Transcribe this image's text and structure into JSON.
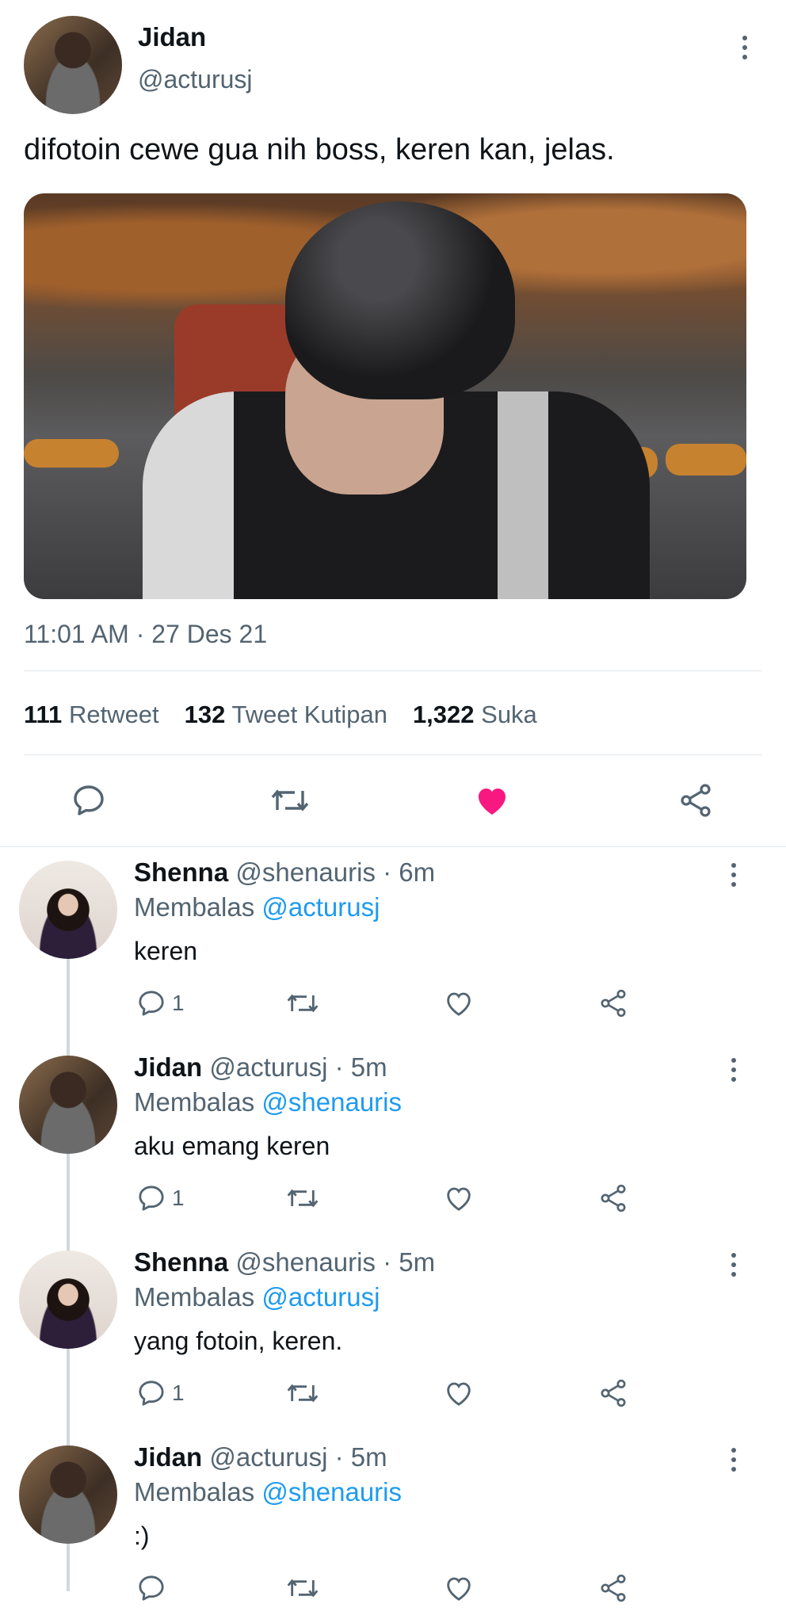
{
  "tweet": {
    "author_name": "Jidan",
    "author_handle": "@acturusj",
    "text": "difotoin cewe gua nih boss, keren kan, jelas.",
    "timestamp": "11:01 AM · 27 Des 21",
    "stats": [
      {
        "count": "111",
        "label": "Retweet"
      },
      {
        "count": "132",
        "label": "Tweet Kutipan"
      },
      {
        "count": "1,322",
        "label": "Suka"
      }
    ],
    "liked": true,
    "accent_like_color": "#f91880"
  },
  "replies": [
    {
      "name": "Shenna",
      "meta": "@shenauris · 6m",
      "reply_prefix": "Membalas",
      "reply_to": "@acturusj",
      "text": "keren",
      "reply_count": "1"
    },
    {
      "name": "Jidan",
      "meta": "@acturusj · 5m",
      "reply_prefix": "Membalas",
      "reply_to": "@shenauris",
      "text": "aku emang keren",
      "reply_count": "1"
    },
    {
      "name": "Shenna",
      "meta": "@shenauris · 5m",
      "reply_prefix": "Membalas",
      "reply_to": "@acturusj",
      "text": "yang fotoin, keren.",
      "reply_count": "1"
    },
    {
      "name": "Jidan",
      "meta": "@acturusj · 5m",
      "reply_prefix": "Membalas",
      "reply_to": "@shenauris",
      "text": ":)",
      "reply_count": ""
    }
  ],
  "colors": {
    "text": "#0f1419",
    "muted": "#536471",
    "link": "#1d9bf0",
    "divider": "#e1e6ea"
  }
}
